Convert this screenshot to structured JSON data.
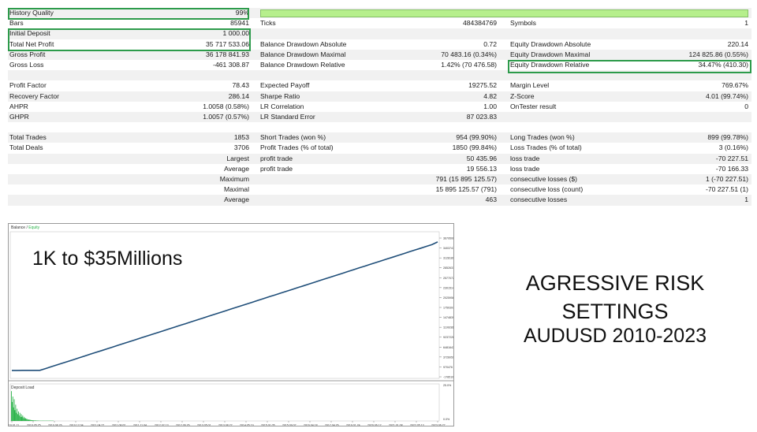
{
  "stats": {
    "rows": [
      {
        "a_label": "History Quality",
        "a_value": "99%",
        "b_label": "",
        "b_value": "",
        "c_label": "",
        "c_value": ""
      },
      {
        "a_label": "Bars",
        "a_value": "85941",
        "b_label": "Ticks",
        "b_value": "484384769",
        "c_label": "Symbols",
        "c_value": "1"
      },
      {
        "a_label": "Initial Deposit",
        "a_value": "1 000.00",
        "b_label": "",
        "b_value": "",
        "c_label": "",
        "c_value": ""
      },
      {
        "a_label": "Total Net Profit",
        "a_value": "35 717 533.06",
        "b_label": "Balance Drawdown Absolute",
        "b_value": "0.72",
        "c_label": "Equity Drawdown Absolute",
        "c_value": "220.14"
      },
      {
        "a_label": "Gross Profit",
        "a_value": "36 178 841.93",
        "b_label": "Balance Drawdown Maximal",
        "b_value": "70 483.16 (0.34%)",
        "c_label": "Equity Drawdown Maximal",
        "c_value": "124 825.86 (0.55%)"
      },
      {
        "a_label": "Gross Loss",
        "a_value": "-461 308.87",
        "b_label": "Balance Drawdown Relative",
        "b_value": "1.42% (70 476.58)",
        "c_label": "Equity Drawdown Relative",
        "c_value": "34.47% (410.30)"
      },
      {
        "a_label": "",
        "a_value": "",
        "b_label": "",
        "b_value": "",
        "c_label": "",
        "c_value": ""
      },
      {
        "a_label": "Profit Factor",
        "a_value": "78.43",
        "b_label": "Expected Payoff",
        "b_value": "19275.52",
        "c_label": "Margin Level",
        "c_value": "769.67%"
      },
      {
        "a_label": "Recovery Factor",
        "a_value": "286.14",
        "b_label": "Sharpe Ratio",
        "b_value": "4.82",
        "c_label": "Z-Score",
        "c_value": "4.01 (99.74%)"
      },
      {
        "a_label": "AHPR",
        "a_value": "1.0058 (0.58%)",
        "b_label": "LR Correlation",
        "b_value": "1.00",
        "c_label": "OnTester result",
        "c_value": "0"
      },
      {
        "a_label": "GHPR",
        "a_value": "1.0057 (0.57%)",
        "b_label": "LR Standard Error",
        "b_value": "87 023.83",
        "c_label": "",
        "c_value": ""
      },
      {
        "a_label": "",
        "a_value": "",
        "b_label": "",
        "b_value": "",
        "c_label": "",
        "c_value": ""
      },
      {
        "a_label": "Total Trades",
        "a_value": "1853",
        "b_label": "Short Trades (won %)",
        "b_value": "954 (99.90%)",
        "c_label": "Long Trades (won %)",
        "c_value": "899 (99.78%)"
      },
      {
        "a_label": "Total Deals",
        "a_value": "3706",
        "b_label": "Profit Trades (% of total)",
        "b_value": "1850 (99.84%)",
        "c_label": "Loss Trades (% of total)",
        "c_value": "3 (0.16%)"
      },
      {
        "a_label": "",
        "a_value": "Largest",
        "b_label": "profit trade",
        "b_value": "50 435.96",
        "c_label": "loss trade",
        "c_value": "-70 227.51"
      },
      {
        "a_label": "",
        "a_value": "Average",
        "b_label": "profit trade",
        "b_value": "19 556.13",
        "c_label": "loss trade",
        "c_value": "-70 166.33"
      },
      {
        "a_label": "",
        "a_value": "Maximum",
        "b_label": "",
        "b_value": "791 (15 895 125.57)",
        "c_label": "consecutive losses ($)",
        "c_value": "1 (-70 227.51)"
      },
      {
        "a_label": "",
        "a_value": "Maximal",
        "b_label": "",
        "b_value": "15 895 125.57 (791)",
        "c_label": "consecutive loss (count)",
        "c_value": "-70 227.51 (1)"
      },
      {
        "a_label": "",
        "a_value": "Average",
        "b_label": "",
        "b_value": "463",
        "c_label": "consecutive losses",
        "c_value": "1"
      },
      {
        "a_label": "",
        "a_value": "",
        "b_label": "",
        "b_value": "",
        "c_label": "",
        "c_value": ""
      }
    ]
  },
  "chart": {
    "legend_balance": "Balance",
    "legend_sep": " / ",
    "legend_equity": "Equity",
    "caption": "1K to $35Millions",
    "drawdown_label": "Deposit Load",
    "balance_color": "#1f4e79",
    "drawdown_color": "#2bb34a",
    "y_ticks": [
      "36795061",
      "34037477",
      "31281894",
      "28526310",
      "25770727",
      "23015143",
      "20259560",
      "17503977",
      "14748393",
      "11992810",
      "9237226",
      "6481643",
      "3726059",
      "970476",
      "-1785108"
    ],
    "dd_ticks": [
      "25.0%",
      "0.0%"
    ],
    "x_ticks": [
      "2010.01.11",
      "2010.05.25",
      "2010.08.26",
      "2010.12.04",
      "2011.04.27",
      "2011.08.02",
      "2011.11.04",
      "2012.02.13",
      "2012.06.26",
      "2013.05.01",
      "2013.08.22",
      "2014.05.19",
      "2015.01.05",
      "2015.09.07",
      "2016.04.18",
      "2017.04.26",
      "2019.01.24",
      "2020.06.12",
      "2021.01.08",
      "2022.05.13",
      "2023.06.27"
    ],
    "balance_series": [
      1000,
      1200,
      1500,
      2500,
      5000,
      12000,
      500000,
      1000000,
      1500000,
      2000000,
      2500000,
      3000000,
      3500000,
      4000000,
      4500000,
      5000000,
      5500000,
      6000000,
      6500000,
      7000000,
      7500000,
      8000000,
      8500000,
      9000000,
      9500000,
      10000000,
      10500000,
      11000000,
      11500000,
      12000000,
      12500000,
      13000000,
      13500000,
      14000000,
      14500000,
      15000000,
      15500000,
      16000000,
      16500000,
      17000000,
      17500000,
      18000000,
      18500000,
      19000000,
      19500000,
      20000000,
      20500000,
      21000000,
      21500000,
      22000000,
      22500000,
      23000000,
      23500000,
      24000000,
      24500000,
      25000000,
      25500000,
      26000000,
      26500000,
      27000000,
      27500000,
      28000000,
      28500000,
      29000000,
      29500000,
      30000000,
      30500000,
      31000000,
      31500000,
      32000000,
      32500000,
      33000000,
      33500000,
      34000000,
      34500000,
      35000000,
      35717533
    ],
    "y_range": [
      -1785108,
      36795061
    ],
    "drawdown_series": [
      22,
      14,
      18,
      10,
      16,
      8,
      12,
      6,
      9,
      5,
      7,
      4,
      6,
      3,
      5,
      3,
      4,
      2,
      3,
      2,
      2,
      1.5,
      1.5,
      1,
      1,
      1,
      0.8,
      0.8,
      0.6,
      0.6,
      0.5,
      0.5,
      0.4,
      0.4,
      0.4,
      0.3,
      0.3,
      0.3,
      0.3,
      0.2,
      0.2,
      0.2,
      0.2,
      0.2,
      0.2,
      0.2,
      0.2,
      0.2,
      0.2,
      0.2,
      0.2,
      0.2,
      0.2,
      0.2,
      0.2,
      0.2,
      0.2,
      0.2,
      0.2,
      0.2
    ],
    "dd_range": [
      0,
      25
    ]
  },
  "captions": {
    "line1": "AGRESSIVE RISK",
    "line2": "SETTINGS",
    "line3": "AUDUSD 2010-2023"
  }
}
